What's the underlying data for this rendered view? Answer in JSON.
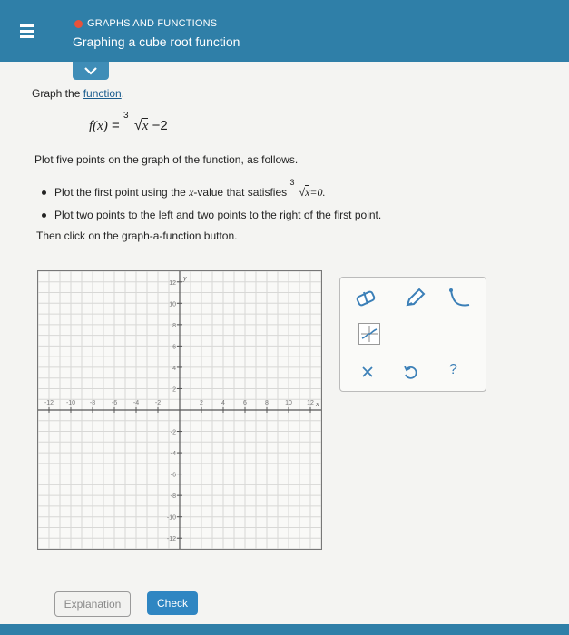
{
  "header": {
    "topic": "GRAPHS AND FUNCTIONS",
    "title": "Graphing a cube root function"
  },
  "instructions": {
    "intro_prefix": "Graph the ",
    "intro_link": "function",
    "intro_suffix": ".",
    "function_lhs": "f(x)",
    "function_eq": "=",
    "function_index": "3",
    "function_radicand": "x",
    "function_tail": "−2",
    "plot_text": "Plot five points on the graph of the function, as follows.",
    "bullet1_prefix": "Plot the first point using the ",
    "bullet1_var": "x",
    "bullet1_mid": "-value that satisfies ",
    "bullet1_index": "3",
    "bullet1_radicand": "x",
    "bullet1_eq": "=0.",
    "bullet2": "Plot two points to the left and two points to the right of the first point.",
    "then_text": "Then click on the graph-a-function button."
  },
  "graph": {
    "x_label": "x",
    "y_label": "y",
    "x_range": [
      -13,
      13
    ],
    "y_range": [
      -13,
      13
    ],
    "x_ticks": [
      "-12",
      "-10",
      "-8",
      "-6",
      "-4",
      "-2",
      "2",
      "4",
      "6",
      "8",
      "10",
      "12"
    ],
    "y_ticks": [
      "12",
      "10",
      "8",
      "6",
      "4",
      "2",
      "-2",
      "-4",
      "-6",
      "-8",
      "-10",
      "-12"
    ]
  },
  "toolbar": {
    "icons": [
      "eraser-icon",
      "pencil-icon",
      "curve-tool-icon",
      "graph-function-icon",
      "clear-icon",
      "undo-icon",
      "help-icon"
    ],
    "help_label": "?"
  },
  "buttons": {
    "explanation": "Explanation",
    "check": "Check"
  },
  "colors": {
    "header": "#2f7fa8",
    "topic_dot": "#e8523a",
    "check_button": "#2f86c2",
    "tool_blue": "#3b7fb7"
  }
}
